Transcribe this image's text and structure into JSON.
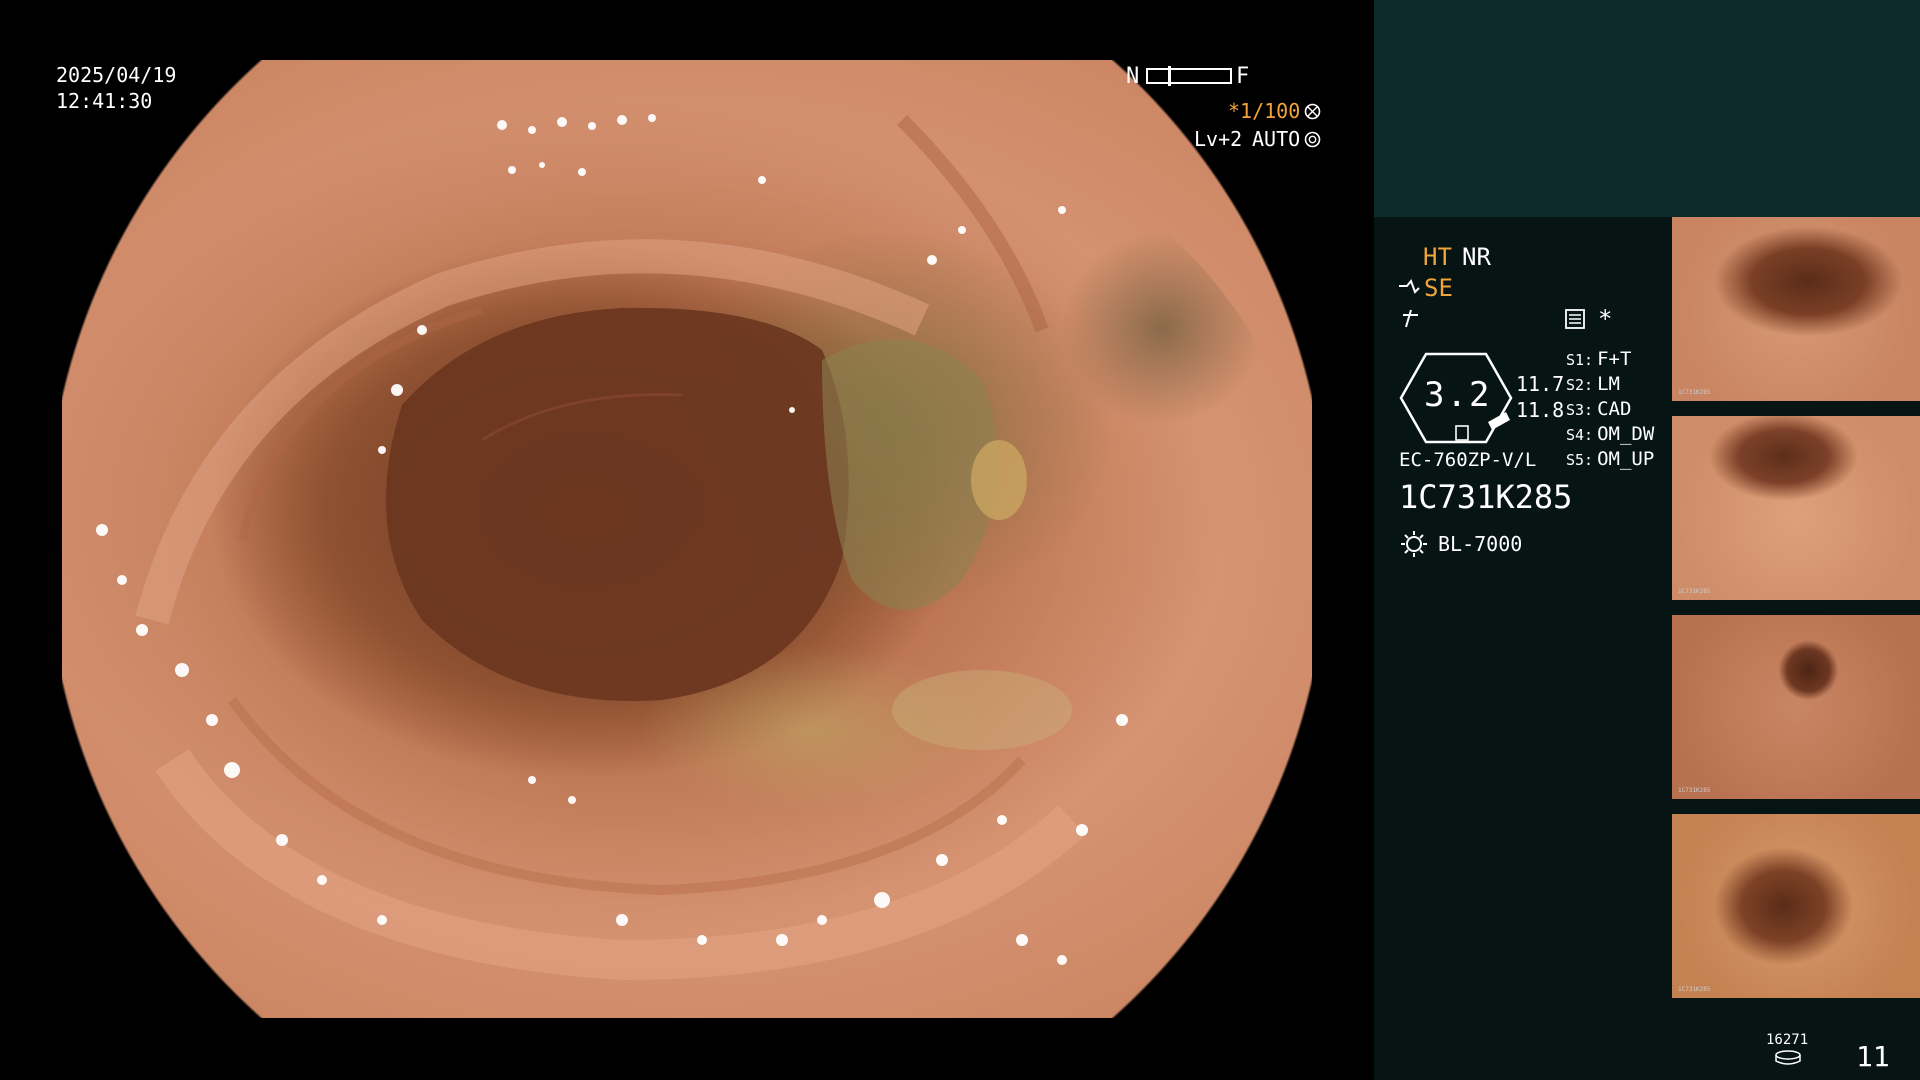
{
  "header": {
    "date": "2025/04/19",
    "time": "12:41:30"
  },
  "top_right": {
    "near_far_left": "N",
    "near_far_right": "F",
    "shutter": "*1/100",
    "level": "Lv+2",
    "mode": "AUTO"
  },
  "side_panel": {
    "ht": "HT",
    "nr": "NR",
    "se": "SE",
    "hex_value": "3.2",
    "val_a": "11.7",
    "val_b": "11.8",
    "asterisk": "*",
    "settings": [
      {
        "key": "S1:",
        "value": "F+T"
      },
      {
        "key": "S2:",
        "value": "LM"
      },
      {
        "key": "S3:",
        "value": "CAD"
      },
      {
        "key": "S4:",
        "value": "OM_DW"
      },
      {
        "key": "S5:",
        "value": "OM_UP"
      }
    ],
    "scope_model": "EC-760ZP-V/L",
    "serial": "1C731K285",
    "light_source": "BL-7000"
  },
  "thumbnails": [
    {
      "serial": "1C731K285"
    },
    {
      "serial": "1C731K285"
    },
    {
      "serial": "1C731K285"
    },
    {
      "serial": "1C731K285"
    }
  ],
  "footer": {
    "disk_count": "16271",
    "image_count": "11"
  },
  "colors": {
    "accent_orange": "#f0a43a",
    "panel_top": "#0e2b2c",
    "panel_body": "#061413"
  }
}
